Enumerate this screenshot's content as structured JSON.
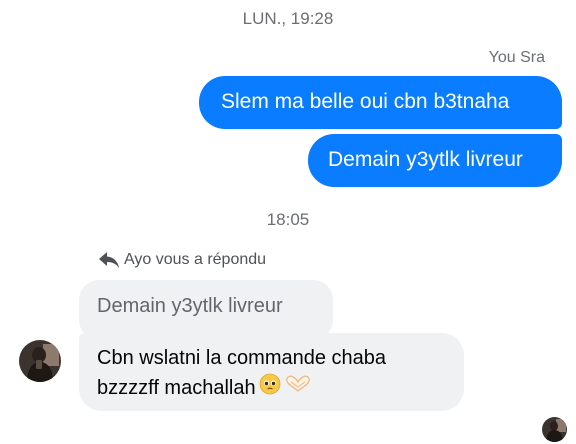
{
  "thread": {
    "timestamp_1": "LUN., 19:28",
    "sender_label": "You Sra",
    "timestamp_2": "18:05"
  },
  "messages_out": [
    {
      "text": "Slem ma belle oui cbn b3tnaha"
    },
    {
      "text": "Demain y3ytlk livreur"
    }
  ],
  "reply": {
    "label": "Ayo vous a répondu",
    "quoted_text": "Demain y3ytlk livreur"
  },
  "message_in": {
    "line_1": "Cbn wslatni la commande chaba",
    "line_2": "bzzzzff machallah"
  },
  "icons": {
    "reply_icon": "reply-arrow-icon",
    "emoji_1": "pleading-face-emoji",
    "emoji_2": "heart-hands-emoji",
    "avatar": "contact-avatar",
    "read_receipt": "seen-avatar"
  },
  "colors": {
    "outgoing_bubble": "#0a7cff",
    "incoming_bubble": "#f0f1f3",
    "meta_text": "#6b6e72"
  }
}
